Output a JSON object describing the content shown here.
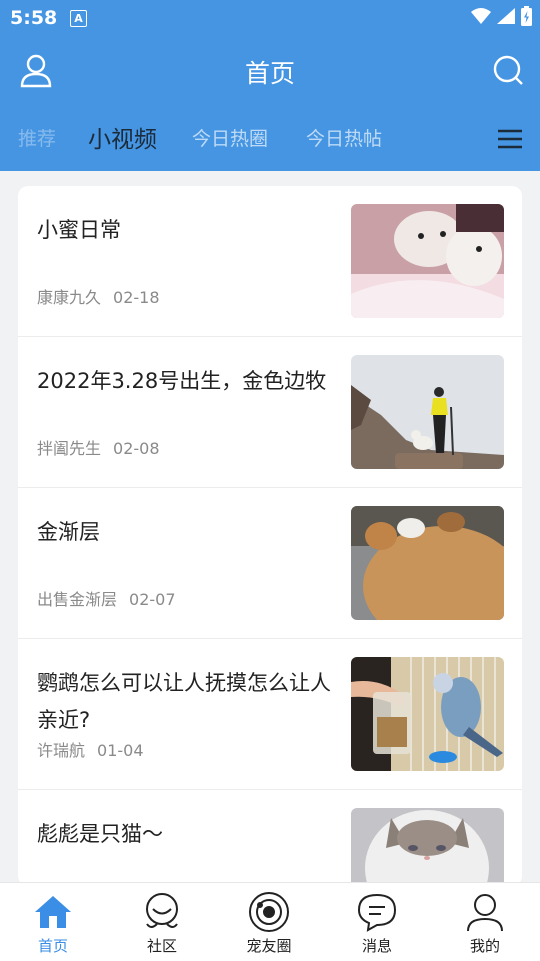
{
  "status_bar": {
    "time": "5:58",
    "notification_letter": "A"
  },
  "header": {
    "title": "首页"
  },
  "tabs": [
    {
      "label": "推荐"
    },
    {
      "label": "小视频"
    },
    {
      "label": "今日热圈"
    },
    {
      "label": "今日热帖"
    }
  ],
  "feed": [
    {
      "title": "小蜜日常",
      "author": "康康九久",
      "date": "02-18",
      "thumb": "puppies"
    },
    {
      "title": "2022年3.28号出生，金色边牧",
      "author": "拌阖先生",
      "date": "02-08",
      "thumb": "hiker-with-dog"
    },
    {
      "title": "金渐层",
      "author": "出售金渐层",
      "date": "02-07",
      "thumb": "golden-cat"
    },
    {
      "title": "鹦鹉怎么可以让人抚摸怎么让人亲近?",
      "author": "许瑞航",
      "date": "01-04",
      "thumb": "budgie-in-cage"
    },
    {
      "title": "彪彪是只猫～",
      "author": "",
      "date": "",
      "thumb": "white-cat"
    }
  ],
  "bottom_nav": [
    {
      "label": "首页",
      "icon": "home-icon",
      "active": true
    },
    {
      "label": "社区",
      "icon": "community-icon"
    },
    {
      "label": "宠友圈",
      "icon": "pet-circle-icon"
    },
    {
      "label": "消息",
      "icon": "message-icon"
    },
    {
      "label": "我的",
      "icon": "profile-icon"
    }
  ],
  "colors": {
    "primary": "#4595e3",
    "active_nav": "#3a8ee6"
  }
}
